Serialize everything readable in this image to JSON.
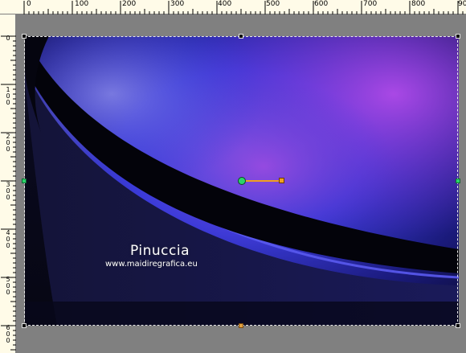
{
  "ruler": {
    "horizontal_labels": [
      "0",
      "100",
      "200",
      "300",
      "400",
      "500",
      "600",
      "700",
      "800",
      "90"
    ],
    "vertical_labels": [
      "0",
      "100",
      "200",
      "300",
      "400",
      "500",
      "600"
    ]
  },
  "image": {
    "signature_name": "Pinuccia",
    "signature_url": "www.maidiregrafica.eu"
  },
  "colors": {
    "ruler_bg": "#fffbe8",
    "workspace_bg": "#808080",
    "accent_blue": "#3a3ae0",
    "accent_purple": "#9a3ad0",
    "handle_green": "#2bd46a",
    "handle_orange": "#f0a020"
  }
}
